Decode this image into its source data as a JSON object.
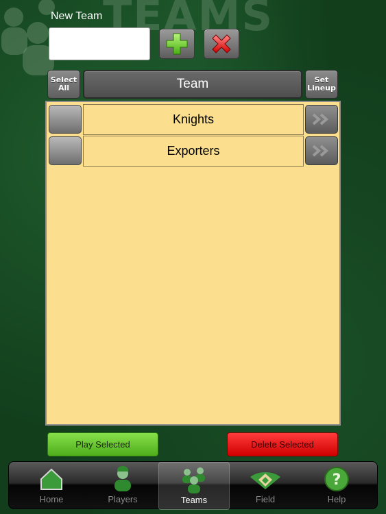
{
  "header": {
    "watermark_title": "TEAMS",
    "new_team_label": "New Team",
    "new_team_value": "",
    "new_team_placeholder": ""
  },
  "list": {
    "select_all_label": "Select All",
    "column_header": "Team",
    "set_lineup_label": "Set Lineup",
    "rows": [
      {
        "name": "Knights",
        "selected": false
      },
      {
        "name": "Exporters",
        "selected": false
      }
    ]
  },
  "actions": {
    "play_selected": "Play Selected",
    "delete_selected": "Delete Selected"
  },
  "tabbar": {
    "active": "Teams",
    "tabs": [
      {
        "label": "Home",
        "icon": "home-icon"
      },
      {
        "label": "Players",
        "icon": "player-icon"
      },
      {
        "label": "Teams",
        "icon": "teams-icon"
      },
      {
        "label": "Field",
        "icon": "field-icon"
      },
      {
        "label": "Help",
        "icon": "help-icon"
      }
    ]
  },
  "colors": {
    "background": "#123e1c",
    "panel": "#fbdf8e",
    "play": "#5fc12a",
    "delete": "#e00000",
    "add": "#6fd23a",
    "clear": "#e11d1d"
  }
}
